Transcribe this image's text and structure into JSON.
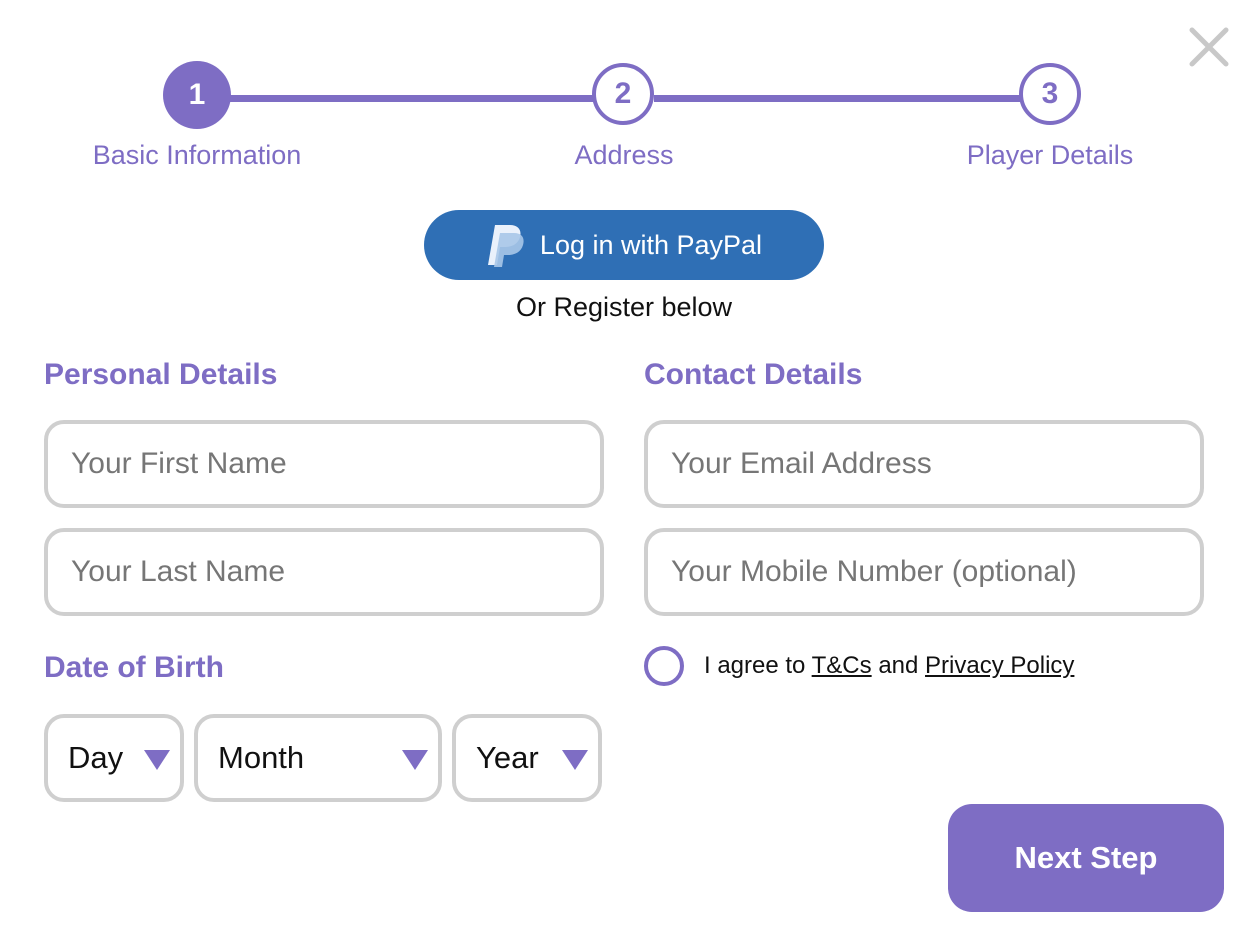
{
  "close_label": "Close",
  "stepper": {
    "current_step": 1,
    "steps": [
      {
        "number": "1",
        "label": "Basic Information",
        "state": "active"
      },
      {
        "number": "2",
        "label": "Address",
        "state": "upcoming"
      },
      {
        "number": "3",
        "label": "Player Details",
        "state": "upcoming"
      }
    ]
  },
  "paypal": {
    "label": "Log in with PayPal",
    "icon": "paypal-logo-icon"
  },
  "or_register": "Or Register below",
  "personal": {
    "title": "Personal Details",
    "first_name_placeholder": "Your First Name",
    "last_name_placeholder": "Your Last Name"
  },
  "contact": {
    "title": "Contact Details",
    "email_placeholder": "Your Email Address",
    "mobile_placeholder": "Your Mobile Number (optional)"
  },
  "dob": {
    "title": "Date of Birth",
    "day": "Day",
    "month": "Month",
    "year": "Year"
  },
  "agree": {
    "prefix": "I agree to",
    "tcs_link": "T&Cs",
    "and": "and",
    "privacy_link": "Privacy Policy",
    "checked": false
  },
  "next_button": "Next Step",
  "colors": {
    "accent": "#7e6dc4",
    "paypal_blue": "#2f6fb5",
    "field_border": "#cfcfcf",
    "placeholder": "#767676"
  }
}
